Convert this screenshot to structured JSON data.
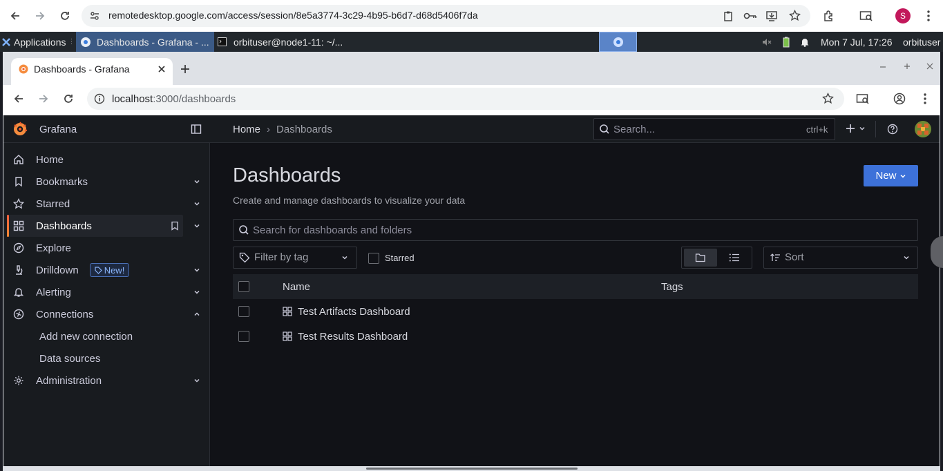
{
  "outer_browser": {
    "url": "remotedesktop.google.com/access/session/8e5a3774-3c29-4b95-b6d7-d68d5406f7da",
    "profile_initial": "S"
  },
  "taskbar": {
    "applications_label": "Applications",
    "windows": [
      {
        "label": "Dashboards - Grafana - ..."
      },
      {
        "label": "orbituser@node1-11: ~/..."
      }
    ],
    "clock": "Mon  7 Jul, 17:26",
    "user": "orbituser"
  },
  "inner_browser": {
    "tab_title": "Dashboards - Grafana",
    "url_host": "localhost",
    "url_path": ":3000/dashboards"
  },
  "grafana": {
    "brand": "Grafana",
    "breadcrumb": [
      "Home",
      "Dashboards"
    ],
    "search_placeholder": "Search...",
    "search_shortcut": "ctrl+k",
    "nav": [
      {
        "label": "Home"
      },
      {
        "label": "Bookmarks"
      },
      {
        "label": "Starred"
      },
      {
        "label": "Dashboards"
      },
      {
        "label": "Explore"
      },
      {
        "label": "Drilldown",
        "badge": "New!"
      },
      {
        "label": "Alerting"
      },
      {
        "label": "Connections"
      },
      {
        "label": "Add new connection"
      },
      {
        "label": "Data sources"
      },
      {
        "label": "Administration"
      }
    ],
    "page": {
      "title": "Dashboards",
      "subtitle": "Create and manage dashboards to visualize your data",
      "new_button": "New",
      "search_placeholder": "Search for dashboards and folders",
      "filter_by_tag": "Filter by tag",
      "starred_label": "Starred",
      "sort_label": "Sort",
      "columns": [
        "Name",
        "Tags"
      ],
      "rows": [
        {
          "name": "Test Artifacts Dashboard"
        },
        {
          "name": "Test Results Dashboard"
        }
      ]
    }
  },
  "colors": {
    "accent_orange": "#f55f3e",
    "primary_blue": "#3d71d9",
    "bg_canvas": "#111217",
    "bg_primary": "#181b1f"
  }
}
